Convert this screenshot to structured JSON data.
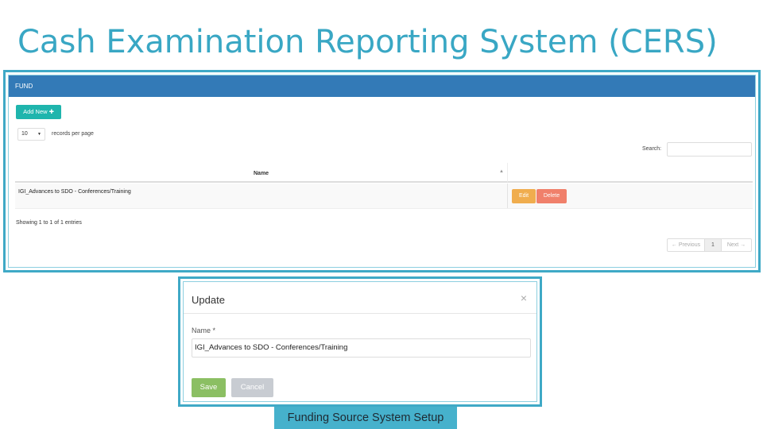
{
  "slide": {
    "title": "Cash Examination Reporting System (CERS)",
    "caption": "Funding Source System Setup"
  },
  "fund_panel": {
    "header": "FUND",
    "add_button": "Add New",
    "add_icon": "plus-icon",
    "records_per_page_value": "10",
    "records_per_page_label": "records per page",
    "search_label": "Search:",
    "search_value": "",
    "columns": [
      "Name"
    ],
    "rows": [
      {
        "name": "IGI_Advances to SDO - Conferences/Training"
      }
    ],
    "edit_label": "Edit",
    "delete_label": "Delete",
    "showing_text": "Showing 1 to 1 of 1 entries",
    "pagination": {
      "prev": "← Previous",
      "current": "1",
      "next": "Next →"
    }
  },
  "update_modal": {
    "title": "Update",
    "close_glyph": "×",
    "field_label": "Name *",
    "field_value": "IGI_Advances to SDO - Conferences/Training",
    "save_label": "Save",
    "cancel_label": "Cancel"
  },
  "colors": {
    "title": "#39a7c4",
    "frame": "#3fa9c6",
    "panel_header": "#337ab7",
    "add_button": "#1fb5ad",
    "edit_button": "#f0ad4e",
    "delete_button": "#f0806b",
    "save_button": "#8bbf63",
    "cancel_button": "#c8ccd2",
    "caption_bg": "#46b1cc"
  }
}
